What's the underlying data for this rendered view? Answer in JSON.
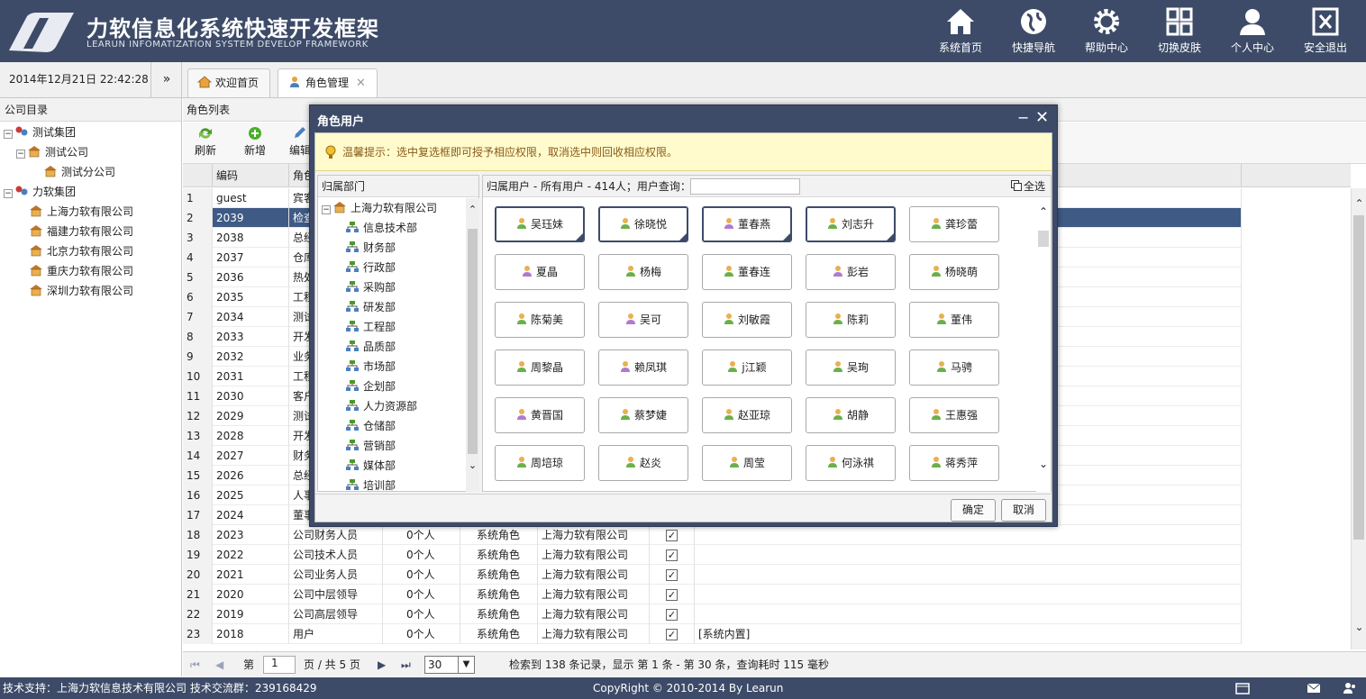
{
  "header": {
    "title": "力软信息化系统快速开发框架",
    "subtitle": "LEARUN INFOMATIZATION SYSTEM DEVELOP FRAMEWORK",
    "nav": [
      {
        "label": "系统首页",
        "icon": "home-icon"
      },
      {
        "label": "快捷导航",
        "icon": "globe-icon"
      },
      {
        "label": "帮助中心",
        "icon": "gear-icon"
      },
      {
        "label": "切换皮肤",
        "icon": "grid-icon"
      },
      {
        "label": "个人中心",
        "icon": "user-icon"
      },
      {
        "label": "安全退出",
        "icon": "close-box-icon"
      }
    ]
  },
  "topbar": {
    "datetime": "2014年12月21日 22:42:28",
    "collapse": "»",
    "tabs": [
      {
        "label": "欢迎首页",
        "icon": "home-icon"
      },
      {
        "label": "角色管理",
        "icon": "user-icon",
        "close": "✕"
      }
    ]
  },
  "left": {
    "title": "公司目录",
    "tree": [
      "测试集团",
      "测试公司",
      "测试分公司",
      "力软集团",
      "上海力软有限公司",
      "福建力软有限公司",
      "北京力软有限公司",
      "重庆力软有限公司",
      "深圳力软有限公司"
    ]
  },
  "main": {
    "title": "角色列表",
    "toolbar": {
      "refresh": "刷新",
      "add": "新增",
      "edit": "编辑"
    },
    "columns": {
      "code": "编码",
      "role": "角色"
    },
    "rows": [
      {
        "n": "1",
        "code": "guest",
        "name": "宾客",
        "count": "",
        "type": "",
        "company": "",
        "check": "",
        "note": ""
      },
      {
        "n": "2",
        "code": "2039",
        "name": "检查",
        "count": "",
        "type": "",
        "company": "",
        "check": "",
        "note": ""
      },
      {
        "n": "3",
        "code": "2038",
        "name": "总经",
        "count": "",
        "type": "",
        "company": "",
        "check": "",
        "note": ""
      },
      {
        "n": "4",
        "code": "2037",
        "name": "仓库",
        "count": "",
        "type": "",
        "company": "",
        "check": "",
        "note": ""
      },
      {
        "n": "5",
        "code": "2036",
        "name": "热处",
        "count": "",
        "type": "",
        "company": "",
        "check": "",
        "note": ""
      },
      {
        "n": "6",
        "code": "2035",
        "name": "工程",
        "count": "",
        "type": "",
        "company": "",
        "check": "",
        "note": ""
      },
      {
        "n": "7",
        "code": "2034",
        "name": "测试",
        "count": "",
        "type": "",
        "company": "",
        "check": "",
        "note": ""
      },
      {
        "n": "8",
        "code": "2033",
        "name": "开发",
        "count": "",
        "type": "",
        "company": "",
        "check": "",
        "note": ""
      },
      {
        "n": "9",
        "code": "2032",
        "name": "业务",
        "count": "",
        "type": "",
        "company": "",
        "check": "",
        "note": ""
      },
      {
        "n": "10",
        "code": "2031",
        "name": "工程",
        "count": "",
        "type": "",
        "company": "",
        "check": "",
        "note": ""
      },
      {
        "n": "11",
        "code": "2030",
        "name": "客户",
        "count": "",
        "type": "",
        "company": "",
        "check": "",
        "note": ""
      },
      {
        "n": "12",
        "code": "2029",
        "name": "测试",
        "count": "",
        "type": "",
        "company": "",
        "check": "",
        "note": ""
      },
      {
        "n": "13",
        "code": "2028",
        "name": "开发",
        "count": "",
        "type": "",
        "company": "",
        "check": "",
        "note": ""
      },
      {
        "n": "14",
        "code": "2027",
        "name": "财务",
        "count": "",
        "type": "",
        "company": "",
        "check": "",
        "note": ""
      },
      {
        "n": "15",
        "code": "2026",
        "name": "总经",
        "count": "",
        "type": "",
        "company": "",
        "check": "",
        "note": ""
      },
      {
        "n": "16",
        "code": "2025",
        "name": "人事",
        "count": "",
        "type": "",
        "company": "",
        "check": "",
        "note": ""
      },
      {
        "n": "17",
        "code": "2024",
        "name": "董事",
        "count": "",
        "type": "",
        "company": "",
        "check": "",
        "note": ""
      },
      {
        "n": "18",
        "code": "2023",
        "name": "公司财务人员",
        "count": "0个人",
        "type": "系统角色",
        "company": "上海力软有限公司",
        "check": "✓",
        "note": ""
      },
      {
        "n": "19",
        "code": "2022",
        "name": "公司技术人员",
        "count": "0个人",
        "type": "系统角色",
        "company": "上海力软有限公司",
        "check": "✓",
        "note": ""
      },
      {
        "n": "20",
        "code": "2021",
        "name": "公司业务人员",
        "count": "0个人",
        "type": "系统角色",
        "company": "上海力软有限公司",
        "check": "✓",
        "note": ""
      },
      {
        "n": "21",
        "code": "2020",
        "name": "公司中层领导",
        "count": "0个人",
        "type": "系统角色",
        "company": "上海力软有限公司",
        "check": "✓",
        "note": ""
      },
      {
        "n": "22",
        "code": "2019",
        "name": "公司高层领导",
        "count": "0个人",
        "type": "系统角色",
        "company": "上海力软有限公司",
        "check": "✓",
        "note": ""
      },
      {
        "n": "23",
        "code": "2018",
        "name": "用户",
        "count": "0个人",
        "type": "系统角色",
        "company": "上海力软有限公司",
        "check": "✓",
        "note": "[系统内置]"
      }
    ],
    "pager": {
      "page_label": "第",
      "page_value": "1",
      "total_label": "页 / 共 5 页",
      "page_size": "30",
      "summary": "检索到 138 条记录，显示 第 1 条 - 第 30 条，查询耗时 115 毫秒"
    }
  },
  "footer": {
    "left": "技术支持：上海力软信息技术有限公司    技术交流群：239168429",
    "center": "CopyRight © 2010-2014 By Learun"
  },
  "modal": {
    "title": "角色用户",
    "hint": "温馨提示：选中复选框即可授予相应权限，取消选中则回收相应权限。",
    "dept_title": "归属部门",
    "dept_root": "上海力软有限公司",
    "depts": [
      "信息技术部",
      "财务部",
      "行政部",
      "采购部",
      "研发部",
      "工程部",
      "品质部",
      "市场部",
      "企划部",
      "人力资源部",
      "仓储部",
      "营销部",
      "媒体部",
      "培训部"
    ],
    "user_head": "归属用户 - 所有用户 - 414人；用户查询：",
    "search_placeholder": "",
    "select_all": "全选",
    "users": [
      {
        "name": "吴珏妹",
        "g": "m",
        "on": true
      },
      {
        "name": "徐晓悦",
        "g": "m",
        "on": true
      },
      {
        "name": "董春燕",
        "g": "f",
        "on": true
      },
      {
        "name": "刘志升",
        "g": "m",
        "on": true
      },
      {
        "name": "龚珍蕾",
        "g": "m",
        "on": false
      },
      {
        "name": "夏晶",
        "g": "f",
        "on": false
      },
      {
        "name": "杨梅",
        "g": "m",
        "on": false
      },
      {
        "name": "董春连",
        "g": "m",
        "on": false
      },
      {
        "name": "彭岩",
        "g": "f",
        "on": false
      },
      {
        "name": "杨晓萌",
        "g": "m",
        "on": false
      },
      {
        "name": "陈菊美",
        "g": "m",
        "on": false
      },
      {
        "name": "吴可",
        "g": "f",
        "on": false
      },
      {
        "name": "刘敏霞",
        "g": "m",
        "on": false
      },
      {
        "name": "陈莉",
        "g": "m",
        "on": false
      },
      {
        "name": "董伟",
        "g": "m",
        "on": false
      },
      {
        "name": "周黎晶",
        "g": "m",
        "on": false
      },
      {
        "name": "赖凤琪",
        "g": "f",
        "on": false
      },
      {
        "name": "j江颖",
        "g": "m",
        "on": false
      },
      {
        "name": "吴珣",
        "g": "m",
        "on": false
      },
      {
        "name": "马骋",
        "g": "m",
        "on": false
      },
      {
        "name": "黄晋国",
        "g": "f",
        "on": false
      },
      {
        "name": "蔡梦婕",
        "g": "m",
        "on": false
      },
      {
        "name": "赵亚琼",
        "g": "m",
        "on": false
      },
      {
        "name": "胡静",
        "g": "m",
        "on": false
      },
      {
        "name": "王惠强",
        "g": "m",
        "on": false
      },
      {
        "name": "周培琼",
        "g": "m",
        "on": false
      },
      {
        "name": "赵炎",
        "g": "m",
        "on": false
      },
      {
        "name": "周莹",
        "g": "m",
        "on": false
      },
      {
        "name": "何泳祺",
        "g": "m",
        "on": false
      },
      {
        "name": "蒋秀萍",
        "g": "m",
        "on": false
      }
    ],
    "ok": "确定",
    "cancel": "取消",
    "min": "−",
    "close": "✕"
  },
  "colors": {
    "header": "#3d4b68",
    "selected_row": "#3e5a85",
    "hint_bg": "#fffbcc"
  }
}
